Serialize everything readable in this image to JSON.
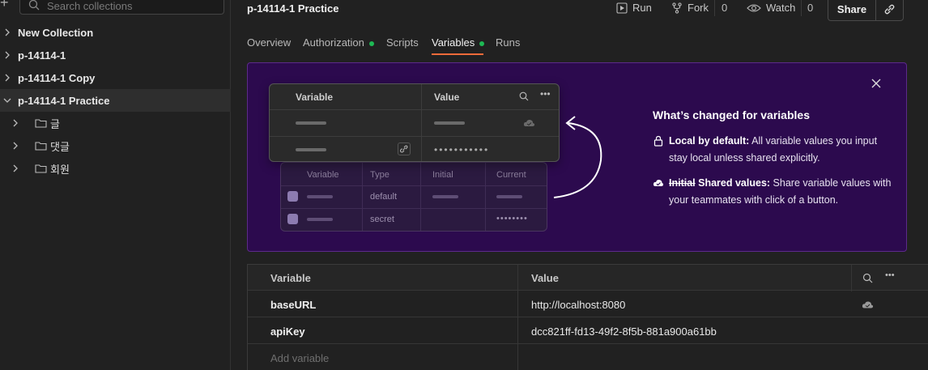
{
  "sidebar": {
    "search_placeholder": "Search collections",
    "items": [
      {
        "label": "New Collection",
        "expanded": false
      },
      {
        "label": "p-14114-1",
        "expanded": false
      },
      {
        "label": "p-14114-1 Copy",
        "expanded": false
      },
      {
        "label": "p-14114-1 Practice",
        "expanded": true,
        "active": true
      }
    ],
    "children": [
      {
        "label": "글"
      },
      {
        "label": "댓글"
      },
      {
        "label": "회원"
      }
    ]
  },
  "header": {
    "title": "p-14114-1 Practice",
    "run_label": "Run",
    "fork_label": "Fork",
    "fork_count": "0",
    "watch_label": "Watch",
    "watch_count": "0",
    "share_label": "Share"
  },
  "tabs": [
    {
      "label": "Overview",
      "dot": false
    },
    {
      "label": "Authorization",
      "dot": true
    },
    {
      "label": "Scripts",
      "dot": false
    },
    {
      "label": "Variables",
      "dot": true,
      "active": true
    },
    {
      "label": "Runs",
      "dot": false
    }
  ],
  "banner": {
    "front_card": {
      "col_variable": "Variable",
      "col_value": "Value",
      "password_mask": "•••••••••••"
    },
    "back_card": {
      "cols": [
        "Variable",
        "Type",
        "Initial",
        "Current"
      ],
      "rows": [
        {
          "type": "default"
        },
        {
          "type": "secret",
          "current_mask": "••••••••"
        }
      ]
    },
    "heading": "What’s changed for variables",
    "item1_bold": "Local by default:",
    "item1_text": " All variable values you input stay local unless shared explicitly.",
    "item2_strike": "Initial",
    "item2_bold": " Shared values:",
    "item2_text": " Share variable values with your teammates with click of a button."
  },
  "variables_table": {
    "col_variable": "Variable",
    "col_value": "Value",
    "rows": [
      {
        "key": "baseURL",
        "value": "http://localhost:8080"
      },
      {
        "key": "apiKey",
        "value": "dcc821ff-fd13-49f2-8f5b-881a900a61bb"
      }
    ],
    "add_placeholder": "Add variable"
  },
  "colors": {
    "accent": "#f26b3a",
    "status_dot": "#1db954",
    "banner_bg": "#2c0a4e"
  }
}
